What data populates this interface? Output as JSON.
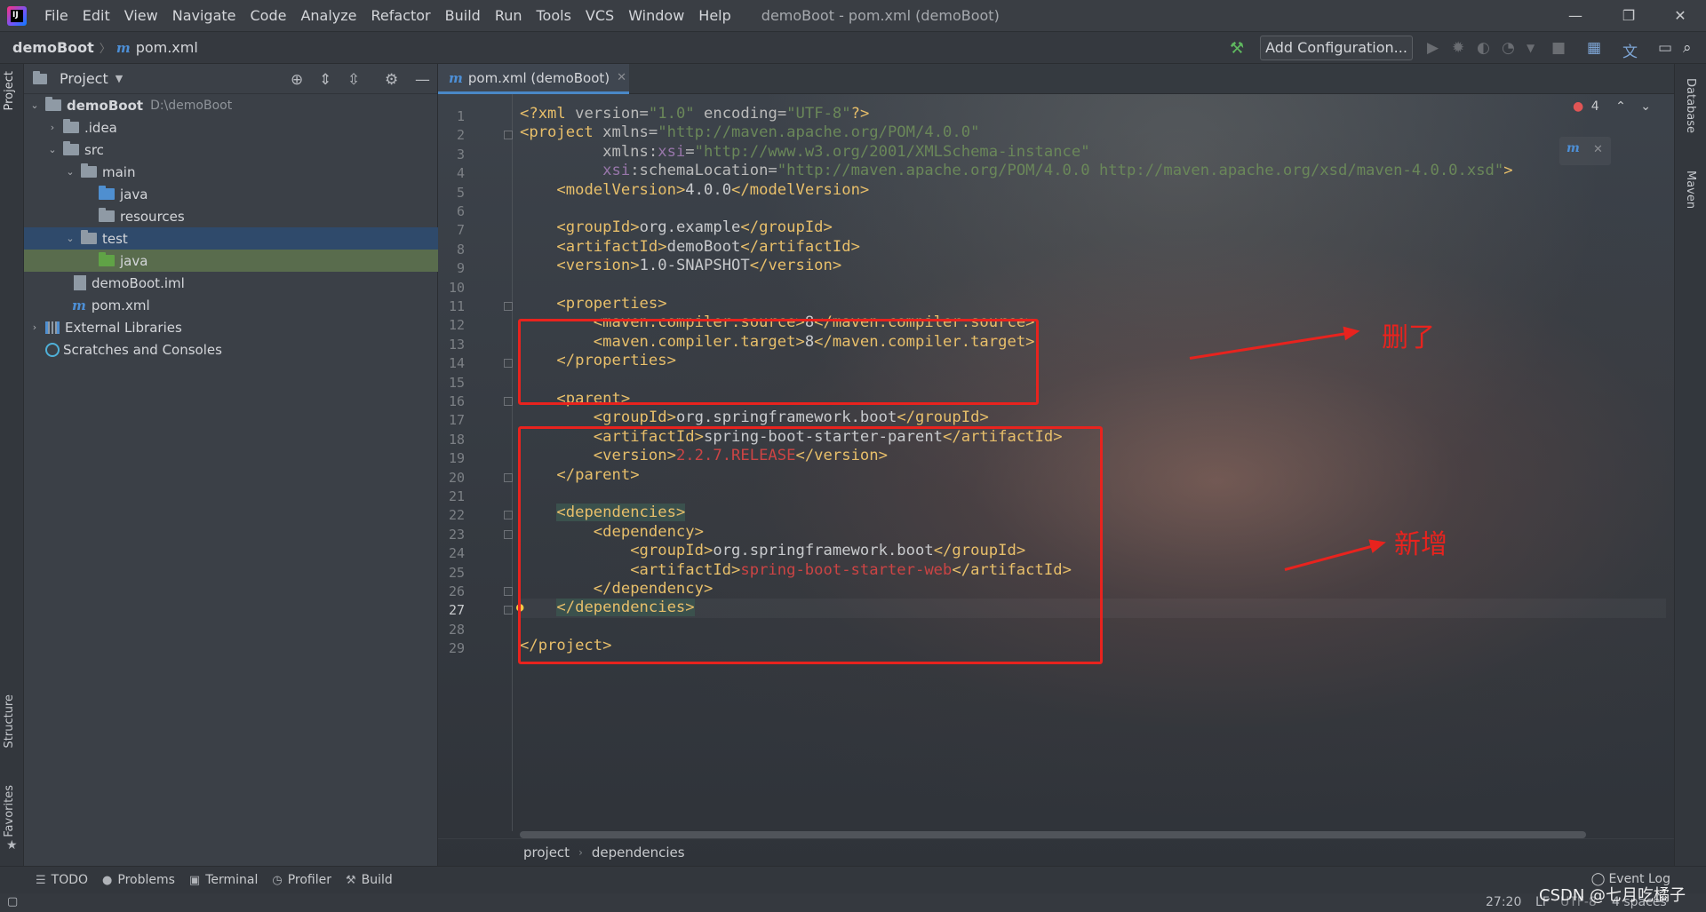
{
  "titlebar": {
    "menus": [
      "File",
      "Edit",
      "View",
      "Navigate",
      "Code",
      "Analyze",
      "Refactor",
      "Build",
      "Run",
      "Tools",
      "VCS",
      "Window",
      "Help"
    ],
    "window_title": "demoBoot - pom.xml (demoBoot)",
    "controls": {
      "minimize": "—",
      "restore": "❐",
      "close": "✕"
    }
  },
  "navbar": {
    "project": "demoBoot",
    "file": "pom.xml",
    "add_configuration": "Add Configuration..."
  },
  "left_strip": {
    "project_tab": "Project",
    "structure_tab": "Structure",
    "favorites_tab": "Favorites"
  },
  "project_panel": {
    "title": "Project",
    "tree": [
      {
        "label": "demoBoot",
        "path": "D:\\demoBoot"
      },
      {
        "label": ".idea"
      },
      {
        "label": "src"
      },
      {
        "label": "main"
      },
      {
        "label": "java"
      },
      {
        "label": "resources"
      },
      {
        "label": "test"
      },
      {
        "label": "java"
      },
      {
        "label": "demoBoot.iml"
      },
      {
        "label": "pom.xml"
      },
      {
        "label": "External Libraries"
      },
      {
        "label": "Scratches and Consoles"
      }
    ]
  },
  "editor": {
    "tab_label": "pom.xml (demoBoot)",
    "error_count": "4",
    "current_line": 27,
    "lines": [
      {
        "n": "1",
        "c": "<?xml version=\"1.0\" encoding=\"UTF-8\"?>"
      },
      {
        "n": "2",
        "c": "<project xmlns=\"http://maven.apache.org/POM/4.0.0\""
      },
      {
        "n": "3",
        "c": "         xmlns:xsi=\"http://www.w3.org/2001/XMLSchema-instance\""
      },
      {
        "n": "4",
        "c": "         xsi:schemaLocation=\"http://maven.apache.org/POM/4.0.0 http://maven.apache.org/xsd/maven-4.0.0.xsd\">"
      },
      {
        "n": "5",
        "c": "    <modelVersion>4.0.0</modelVersion>"
      },
      {
        "n": "6",
        "c": ""
      },
      {
        "n": "7",
        "c": "    <groupId>org.example</groupId>"
      },
      {
        "n": "8",
        "c": "    <artifactId>demoBoot</artifactId>"
      },
      {
        "n": "9",
        "c": "    <version>1.0-SNAPSHOT</version>"
      },
      {
        "n": "10",
        "c": ""
      },
      {
        "n": "11",
        "c": "    <properties>"
      },
      {
        "n": "12",
        "c": "        <maven.compiler.source>8</maven.compiler.source>"
      },
      {
        "n": "13",
        "c": "        <maven.compiler.target>8</maven.compiler.target>"
      },
      {
        "n": "14",
        "c": "    </properties>"
      },
      {
        "n": "15",
        "c": ""
      },
      {
        "n": "16",
        "c": "    <parent>"
      },
      {
        "n": "17",
        "c": "        <groupId>org.springframework.boot</groupId>"
      },
      {
        "n": "18",
        "c": "        <artifactId>spring-boot-starter-parent</artifactId>"
      },
      {
        "n": "19",
        "c": "        <version>2.2.7.RELEASE</version>"
      },
      {
        "n": "20",
        "c": "    </parent>"
      },
      {
        "n": "21",
        "c": ""
      },
      {
        "n": "22",
        "c": "    <dependencies>"
      },
      {
        "n": "23",
        "c": "        <dependency>"
      },
      {
        "n": "24",
        "c": "            <groupId>org.springframework.boot</groupId>"
      },
      {
        "n": "25",
        "c": "            <artifactId>spring-boot-starter-web</artifactId>"
      },
      {
        "n": "26",
        "c": "        </dependency>"
      },
      {
        "n": "27",
        "c": "    </dependencies>"
      },
      {
        "n": "28",
        "c": ""
      },
      {
        "n": "29",
        "c": "</project>"
      }
    ],
    "annotations": {
      "deleted": "删了",
      "added": "新增"
    },
    "breadcrumbs": [
      "project",
      "dependencies"
    ]
  },
  "right_strip": {
    "database_tab": "Database",
    "maven_tab": "Maven"
  },
  "bottombar": {
    "items": [
      "TODO",
      "Problems",
      "Terminal",
      "Profiler",
      "Build"
    ],
    "event_log": "Event Log"
  },
  "statusbar": {
    "position": "27:20",
    "line_sep": "LF",
    "encoding": "UTF-8",
    "indent": "4 spaces"
  },
  "watermark": "CSDN @七月吃橘子",
  "colors": {
    "tag": "#e8bf6a",
    "attr": "#bababa",
    "string": "#6a8759",
    "namespace": "#9876aa",
    "annotation": "#e8231e",
    "accent": "#4a88c7"
  }
}
